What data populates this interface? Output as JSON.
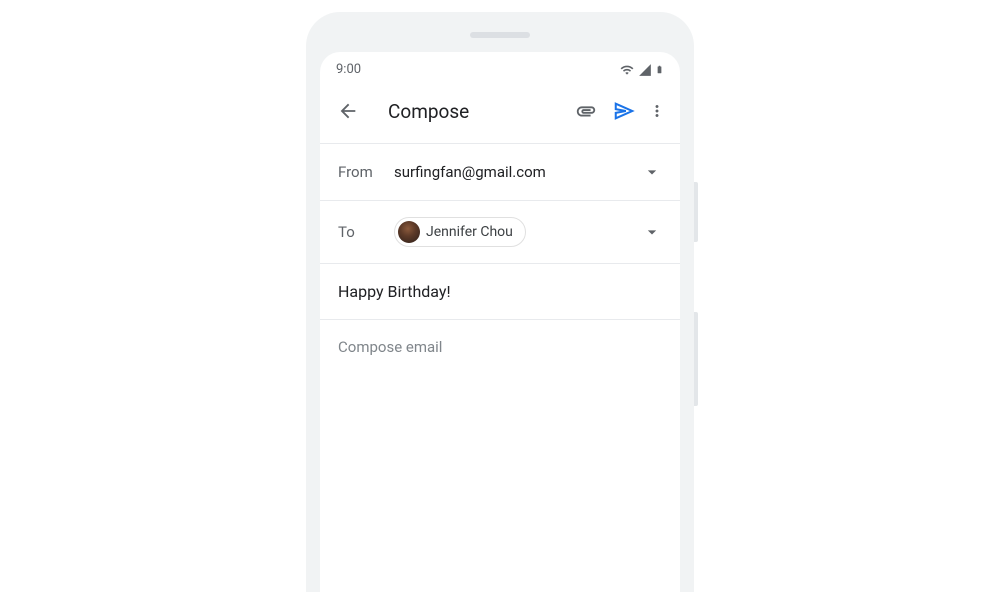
{
  "statusbar": {
    "time": "9:00"
  },
  "toolbar": {
    "title": "Compose"
  },
  "fields": {
    "from_label": "From",
    "from_value": "surfingfan@gmail.com",
    "to_label": "To",
    "to_chip_name": "Jennifer Chou"
  },
  "subject": "Happy Birthday!",
  "body_placeholder": "Compose email",
  "colors": {
    "accent": "#1a73e8"
  }
}
